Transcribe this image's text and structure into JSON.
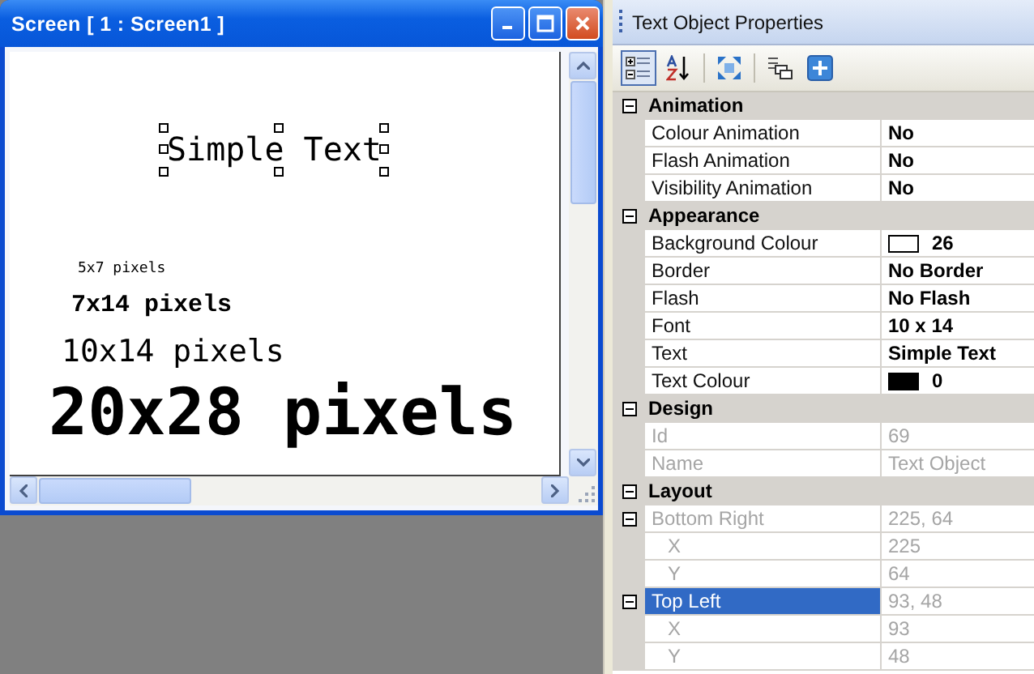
{
  "screen_window": {
    "title": "Screen [ 1 : Screen1 ]",
    "text_objects": [
      {
        "text": "Simple Text",
        "selected": true
      },
      {
        "text": "5x7 pixels",
        "selected": false
      },
      {
        "text": "7x14 pixels",
        "selected": false
      },
      {
        "text": "10x14 pixels",
        "selected": false
      },
      {
        "text": "20x28 pixels",
        "selected": false
      }
    ]
  },
  "properties_panel": {
    "title": "Text Object Properties",
    "toolbar": [
      {
        "kind": "categorized",
        "selected": true
      },
      {
        "kind": "alphabetical",
        "selected": false
      },
      {
        "kind": "expand",
        "selected": false
      },
      {
        "kind": "pages",
        "selected": false
      },
      {
        "kind": "add",
        "selected": false
      }
    ],
    "categories": [
      {
        "name": "Animation",
        "expanded": true,
        "properties": [
          {
            "kind": "text",
            "name": "Colour Animation",
            "value": "No",
            "disabled": false,
            "selected": false
          },
          {
            "kind": "text",
            "name": "Flash Animation",
            "value": "No",
            "disabled": false,
            "selected": false
          },
          {
            "kind": "text",
            "name": "Visibility Animation",
            "value": "No",
            "disabled": false,
            "selected": false
          }
        ]
      },
      {
        "name": "Appearance",
        "expanded": true,
        "properties": [
          {
            "kind": "colour",
            "name": "Background Colour",
            "value": "26",
            "color": "#ffffff",
            "disabled": false,
            "selected": false
          },
          {
            "kind": "text",
            "name": "Border",
            "value": "No Border",
            "disabled": false,
            "selected": false
          },
          {
            "kind": "text",
            "name": "Flash",
            "value": "No Flash",
            "disabled": false,
            "selected": false
          },
          {
            "kind": "text",
            "name": "Font",
            "value": "10 x 14",
            "disabled": false,
            "selected": false
          },
          {
            "kind": "text",
            "name": "Text",
            "value": "Simple Text",
            "disabled": false,
            "selected": false
          },
          {
            "kind": "colour",
            "name": "Text Colour",
            "value": "0",
            "color": "#000000",
            "disabled": false,
            "selected": false
          }
        ]
      },
      {
        "name": "Design",
        "expanded": true,
        "properties": [
          {
            "kind": "text",
            "name": "Id",
            "value": "69",
            "disabled": true,
            "selected": false
          },
          {
            "kind": "text",
            "name": "Name",
            "value": "Text Object",
            "disabled": true,
            "selected": false
          }
        ]
      },
      {
        "name": "Layout",
        "expanded": true,
        "properties": [
          {
            "kind": "text",
            "name": "Bottom Right",
            "value": "225, 64",
            "disabled": true,
            "selected": false,
            "expanded": true,
            "children": [
              {
                "kind": "text",
                "name": "X",
                "value": "225",
                "disabled": true,
                "selected": false
              },
              {
                "kind": "text",
                "name": "Y",
                "value": "64",
                "disabled": true,
                "selected": false
              }
            ]
          },
          {
            "kind": "text",
            "name": "Top Left",
            "value": "93, 48",
            "disabled": true,
            "selected": true,
            "expanded": true,
            "children": [
              {
                "kind": "text",
                "name": "X",
                "value": "93",
                "disabled": true,
                "selected": false
              },
              {
                "kind": "text",
                "name": "Y",
                "value": "48",
                "disabled": true,
                "selected": false
              }
            ]
          }
        ]
      }
    ]
  }
}
